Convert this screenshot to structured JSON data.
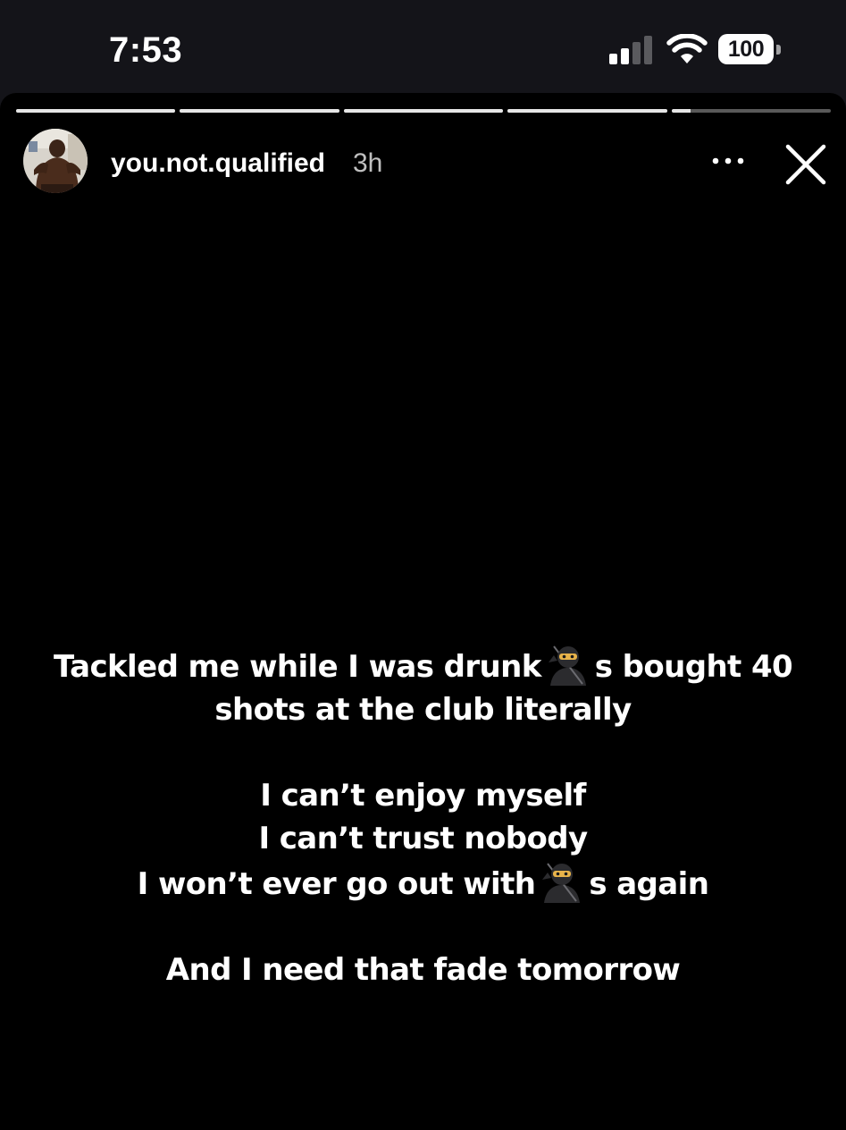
{
  "status_bar": {
    "time": "7:53",
    "battery": "100",
    "signal_icon": "cellular-signal-icon",
    "wifi_icon": "wifi-icon"
  },
  "story": {
    "segments": 5,
    "current_segment": 5,
    "current_segment_progress": 0.12,
    "username": "you.not.qualified",
    "time_ago": "3h",
    "more_icon": "more-dots-icon",
    "close_icon": "close-icon",
    "emoji": "ninja-emoji",
    "caption": {
      "line1_a": "Tackled me while I was drunk",
      "line1_b": "s bought 40",
      "line2": "shots at the club literally",
      "line3": "I can’t enjoy myself",
      "line4": "I can’t trust nobody",
      "line5_a": "I won’t ever go out with",
      "line5_b": "s again",
      "line6": "And I need that fade tomorrow"
    }
  }
}
